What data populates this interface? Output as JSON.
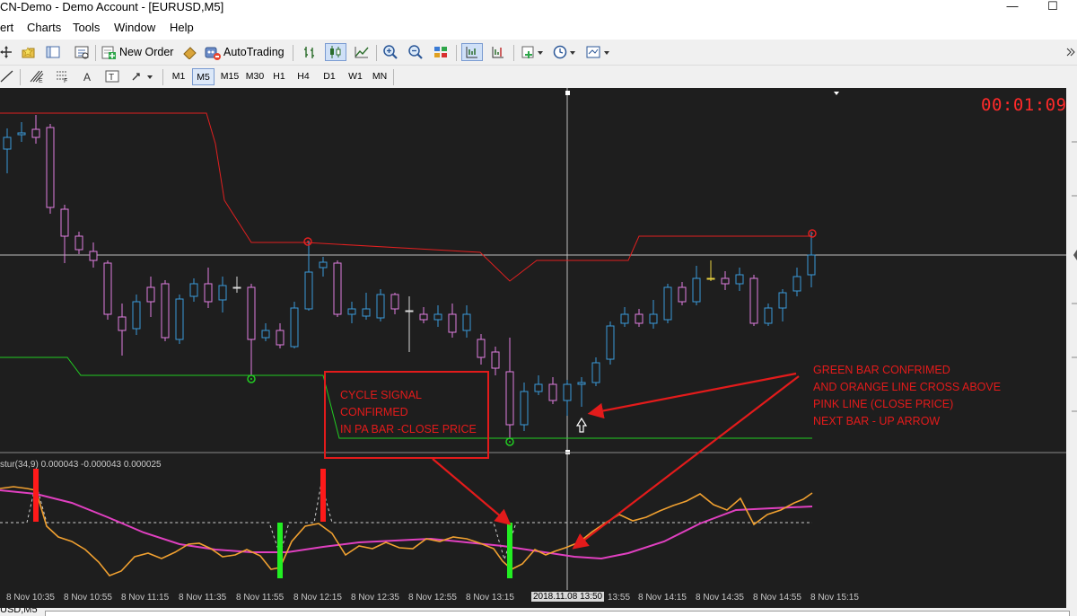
{
  "window": {
    "title": "CN-Demo - Demo Account - [EURUSD,M5]",
    "minimize": "—",
    "maximize": "☐"
  },
  "menu": [
    "ert",
    "Charts",
    "Tools",
    "Window",
    "Help"
  ],
  "toolbar": {
    "new_order": "New Order",
    "auto_trading": "AutoTrading"
  },
  "timeframes": [
    "M1",
    "M5",
    "M15",
    "M30",
    "H1",
    "H4",
    "D1",
    "W1",
    "MN"
  ],
  "active_timeframe": "M5",
  "chart": {
    "symbol": "EURUSD",
    "period": "M5",
    "countdown": "00:01:09",
    "indicator_label": "stur(34,9) 0.000043 -0.000043 0.000025",
    "annotation_left": [
      "CYCLE SIGNAL",
      "CONFIRMED",
      "IN PA BAR -CLOSE PRICE"
    ],
    "annotation_right": [
      "GREEN BAR CONFRIMED",
      "AND ORANGE LINE CROSS ABOVE",
      "PINK LINE (CLOSE PRICE)",
      "NEXT BAR - UP ARROW"
    ],
    "time_axis": [
      "8 Nov 10:35",
      "8 Nov 10:55",
      "8 Nov 11:15",
      "8 Nov 11:35",
      "8 Nov 11:55",
      "8 Nov 12:15",
      "8 Nov 12:35",
      "8 Nov 12:55",
      "8 Nov 13:15",
      "2018.11.08 13:50",
      "13:55",
      "8 Nov 14:15",
      "8 Nov 14:35",
      "8 Nov 14:55",
      "8 Nov 15:15"
    ],
    "crosshair_time": "2018.11.08 13:50",
    "colors": {
      "background": "#1e1e1e",
      "bull_candle": "#3a9ad9",
      "bear_candle": "#e07ee0",
      "upper_band": "#e02020",
      "lower_band": "#22cc22",
      "orange_line": "#f0a030",
      "pink_line": "#e040c0",
      "annotation": "#e31b1b"
    }
  },
  "status_bar": {
    "tab": "USD,M5"
  }
}
